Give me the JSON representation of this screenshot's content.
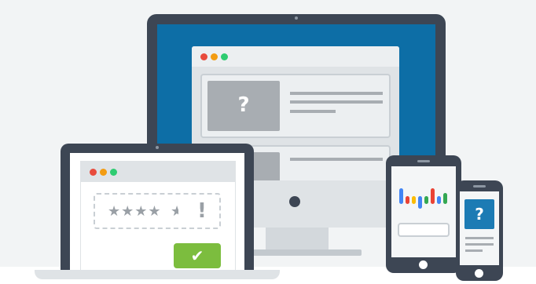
{
  "colors": {
    "page_background": "#f2f4f5",
    "device_frame": "#3d4654",
    "desktop_screen": "#0d6ea6",
    "window_gray": "#dfe3e6",
    "placeholder_gray": "#a8adb2",
    "dot_red": "#e84b3c",
    "dot_orange": "#f39c12",
    "dot_green": "#2ecc71",
    "check_green": "#7cbd3e",
    "phone_blue": "#1c7bb4",
    "star_gray": "#9aa0a6"
  },
  "desktop": {
    "placeholder_symbol": "?",
    "lines": 3
  },
  "laptop": {
    "rating": {
      "value": 4.5,
      "max": 5,
      "stars_text": "★★★★",
      "half_star": "★",
      "alert_symbol": "!"
    },
    "confirm_symbol": "✔"
  },
  "tablet": {
    "logo_bars": [
      "#4285f4",
      "#ea4335",
      "#fbbc05",
      "#4285f4",
      "#34a853",
      "#ea4335",
      "#4285f4",
      "#34a853"
    ]
  },
  "phone": {
    "placeholder_symbol": "?"
  },
  "icons": {
    "question": "question-mark-icon",
    "star": "star-icon",
    "alert": "exclamation-icon",
    "check": "checkmark-icon"
  }
}
